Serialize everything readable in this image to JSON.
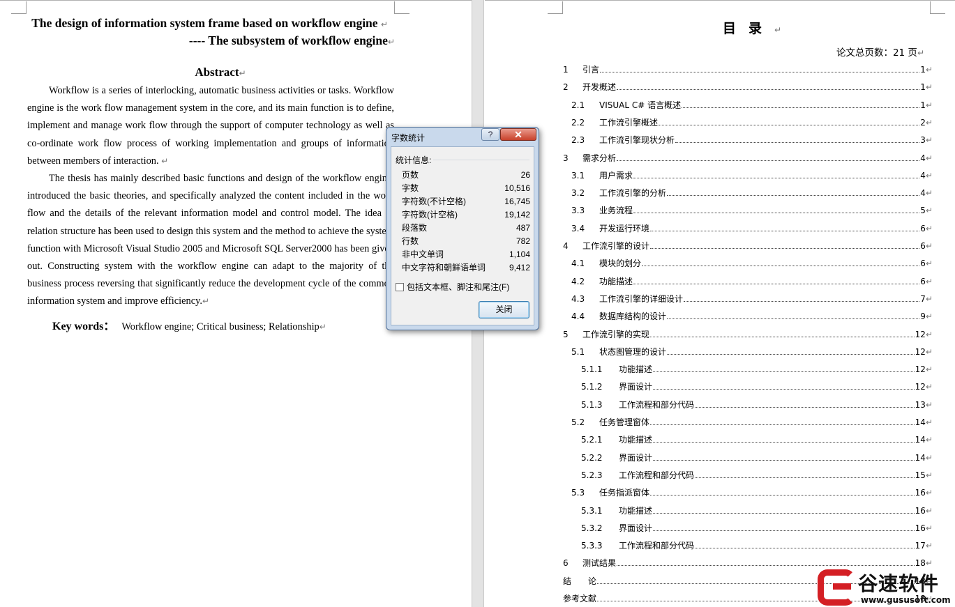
{
  "left_page": {
    "title_line1": "The design of information system frame based on workflow engine",
    "title_line2": "---- The subsystem of workflow engine",
    "abstract_heading": "Abstract",
    "paragraph1": "Workflow is a series of interlocking, automatic business activities or tasks. Workflow engine is the work flow management system in the core, and its main function is to define, implement and manage work flow through the support of computer technology as well as co-ordinate work flow process of working implementation and groups of information between members of interaction.",
    "paragraph2": "The thesis has mainly described basic functions and design of the workflow engine, introduced the basic theories, and specifically analyzed the content included in the work flow and the details of the relevant information model and control model. The idea of relation structure has been used to design this system and the method to achieve the system function with Microsoft Visual Studio 2005 and Microsoft SQL Server2000 has been given out. Constructing system with the workflow engine can adapt to the majority of the business process reversing that significantly reduce the development cycle of the common information system and improve efficiency.",
    "keywords_label": "Key words：",
    "keywords_value": "Workflow engine; Critical business; Relationship"
  },
  "dialog": {
    "title": "字数统计",
    "help_label": "?",
    "close_x": "✕",
    "section_label": "统计信息:",
    "stats": [
      {
        "label": "页数",
        "value": "26"
      },
      {
        "label": "字数",
        "value": "10,516"
      },
      {
        "label": "字符数(不计空格)",
        "value": "16,745"
      },
      {
        "label": "字符数(计空格)",
        "value": "19,142"
      },
      {
        "label": "段落数",
        "value": "487"
      },
      {
        "label": "行数",
        "value": "782"
      },
      {
        "label": "非中文单词",
        "value": "1,104"
      },
      {
        "label": "中文字符和朝鲜语单词",
        "value": "9,412"
      }
    ],
    "checkbox_label": "包括文本框、脚注和尾注(F)",
    "close_button": "关闭"
  },
  "toc": {
    "title": "目录",
    "total_pages": "论文总页数：21 页",
    "entries": [
      {
        "num": "1",
        "text": "引言",
        "page": "1"
      },
      {
        "num": "2",
        "text": "开发概述",
        "page": "1"
      },
      {
        "num": "2.1",
        "text": "VISUAL C# 语言概述",
        "page": "1"
      },
      {
        "num": "2.2",
        "text": "工作流引擎概述",
        "page": "2"
      },
      {
        "num": "2.3",
        "text": "工作流引擎现状分析",
        "page": "3"
      },
      {
        "num": "3",
        "text": "需求分析",
        "page": "4"
      },
      {
        "num": "3.1",
        "text": "用户需求",
        "page": "4"
      },
      {
        "num": "3.2",
        "text": "工作流引擎的分析",
        "page": "4"
      },
      {
        "num": "3.3",
        "text": "业务流程",
        "page": "5"
      },
      {
        "num": "3.4",
        "text": "开发运行环境",
        "page": "6"
      },
      {
        "num": "4",
        "text": "工作流引擎的设计",
        "page": "6"
      },
      {
        "num": "4.1",
        "text": "模块的划分",
        "page": "6"
      },
      {
        "num": "4.2",
        "text": "功能描述",
        "page": "6"
      },
      {
        "num": "4.3",
        "text": "工作流引擎的详细设计",
        "page": "7"
      },
      {
        "num": "4.4",
        "text": "数据库结构的设计",
        "page": "9"
      },
      {
        "num": "5",
        "text": "工作流引擎的实现",
        "page": "12"
      },
      {
        "num": "5.1",
        "text": "状态图管理的设计",
        "page": "12"
      },
      {
        "num": "5.1.1",
        "text": "功能描述",
        "page": "12"
      },
      {
        "num": "5.1.2",
        "text": "界面设计",
        "page": "12"
      },
      {
        "num": "5.1.3",
        "text": "工作流程和部分代码",
        "page": "13"
      },
      {
        "num": "5.2",
        "text": "任务管理窗体",
        "page": "14"
      },
      {
        "num": "5.2.1",
        "text": "功能描述",
        "page": "14"
      },
      {
        "num": "5.2.2",
        "text": "界面设计",
        "page": "14"
      },
      {
        "num": "5.2.3",
        "text": "工作流程和部分代码",
        "page": "15"
      },
      {
        "num": "5.3",
        "text": "任务指派窗体",
        "page": "16"
      },
      {
        "num": "5.3.1",
        "text": "功能描述",
        "page": "16"
      },
      {
        "num": "5.3.2",
        "text": "界面设计",
        "page": "16"
      },
      {
        "num": "5.3.3",
        "text": "工作流程和部分代码",
        "page": "17"
      },
      {
        "num": "6",
        "text": "测试结果",
        "page": "18"
      },
      {
        "num": "",
        "text": "结　　论",
        "page": "18"
      },
      {
        "num": "",
        "text": "参考文献",
        "page": "18"
      }
    ]
  },
  "watermark": {
    "brand_cn": "谷速软件",
    "url": "www.gususoft.com"
  }
}
